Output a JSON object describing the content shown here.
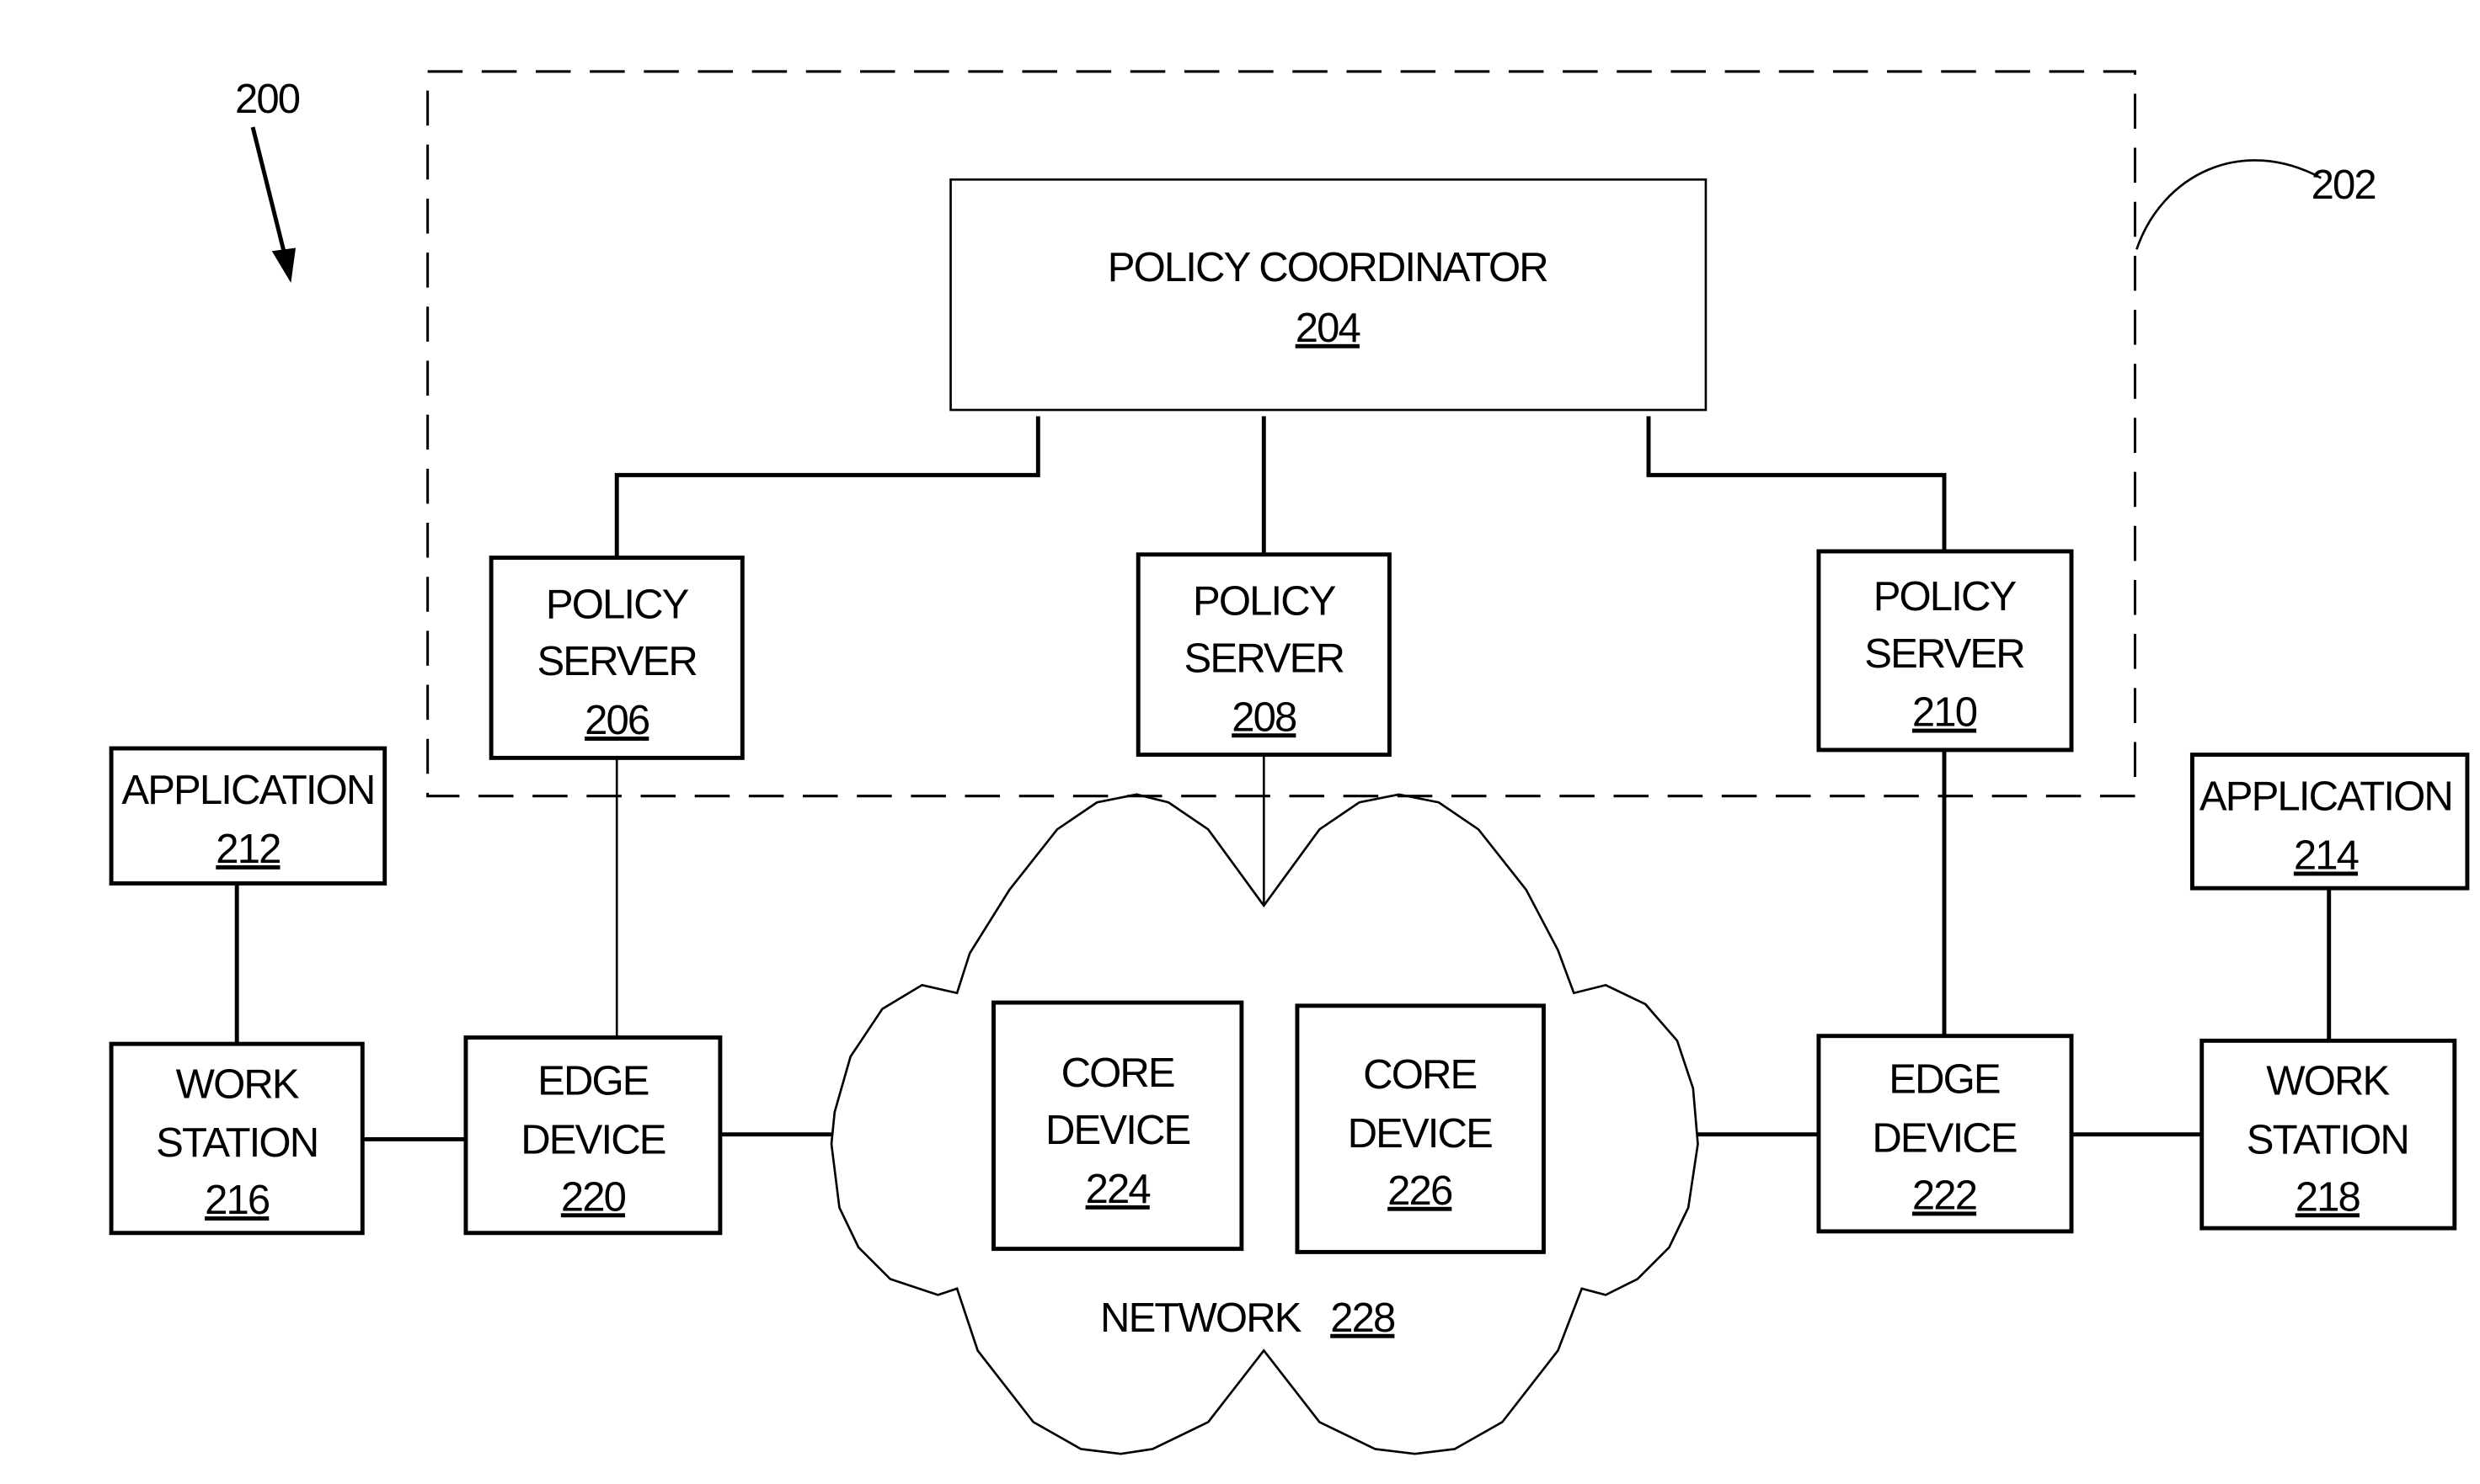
{
  "figure": {
    "reference_number": "200",
    "policy_domain_reference": "202"
  },
  "nodes": {
    "policy_coordinator": {
      "title": "POLICY COORDINATOR",
      "ref": "204"
    },
    "policy_server_206": {
      "line1": "POLICY",
      "line2": "SERVER",
      "ref": "206"
    },
    "policy_server_208": {
      "line1": "POLICY",
      "line2": "SERVER",
      "ref": "208"
    },
    "policy_server_210": {
      "line1": "POLICY",
      "line2": "SERVER",
      "ref": "210"
    },
    "application_212": {
      "line1": "APPLICATION",
      "ref": "212"
    },
    "application_214": {
      "line1": "APPLICATION",
      "ref": "214"
    },
    "work_station_216": {
      "line1": "WORK",
      "line2": "STATION",
      "ref": "216"
    },
    "work_station_218": {
      "line1": "WORK",
      "line2": "STATION",
      "ref": "218"
    },
    "edge_device_220": {
      "line1": "EDGE",
      "line2": "DEVICE",
      "ref": "220"
    },
    "edge_device_222": {
      "line1": "EDGE",
      "line2": "DEVICE",
      "ref": "222"
    },
    "core_device_224": {
      "line1": "CORE",
      "line2": "DEVICE",
      "ref": "224"
    },
    "core_device_226": {
      "line1": "CORE",
      "line2": "DEVICE",
      "ref": "226"
    },
    "network_228": {
      "title": "NETWORK",
      "ref": "228"
    }
  },
  "connections": [
    [
      "policy_coordinator",
      "policy_server_206"
    ],
    [
      "policy_coordinator",
      "policy_server_208"
    ],
    [
      "policy_coordinator",
      "policy_server_210"
    ],
    [
      "policy_server_206",
      "edge_device_220"
    ],
    [
      "policy_server_208",
      "network_228"
    ],
    [
      "policy_server_210",
      "edge_device_222"
    ],
    [
      "application_212",
      "work_station_216"
    ],
    [
      "application_214",
      "work_station_218"
    ],
    [
      "work_station_216",
      "edge_device_220"
    ],
    [
      "edge_device_220",
      "network_228"
    ],
    [
      "network_228",
      "edge_device_222"
    ],
    [
      "edge_device_222",
      "work_station_218"
    ]
  ]
}
